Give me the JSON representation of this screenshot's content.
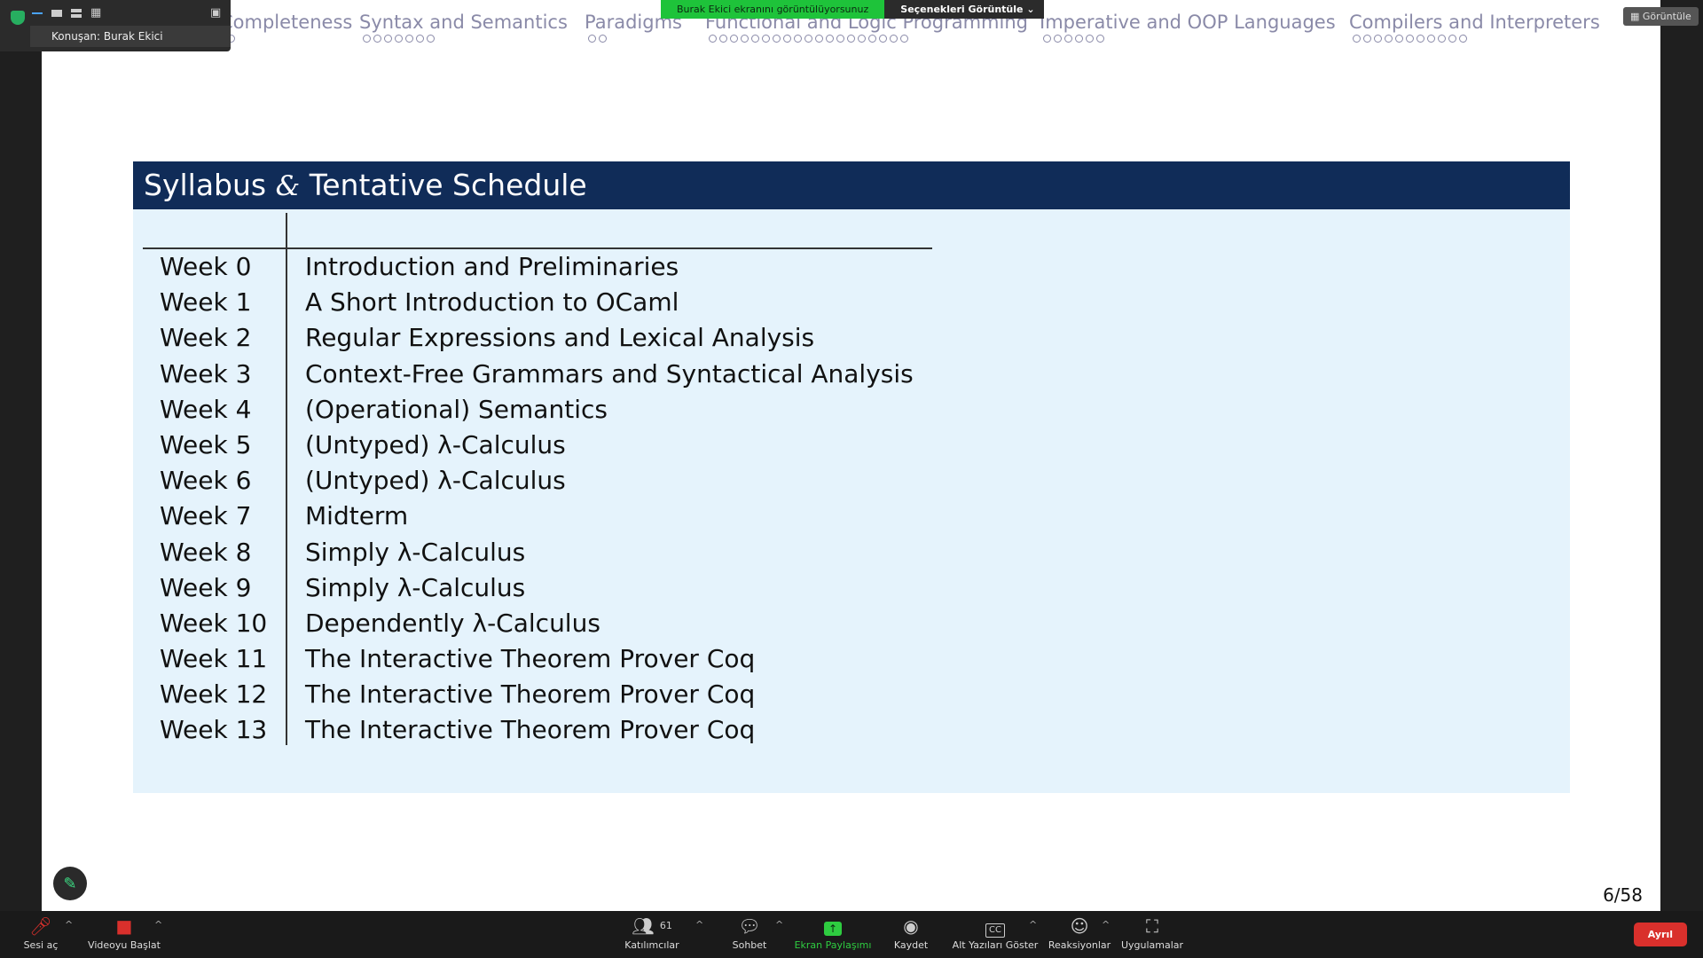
{
  "meeting": {
    "speaker_label": "Konuşan: Burak Ekici",
    "share_banner": "Burak Ekici ekranını görüntülüyorsunuz",
    "view_options": "Seçenekleri Görüntüle",
    "view_button": "Görüntüle"
  },
  "slide": {
    "nav": [
      {
        "label": "g Completeness",
        "dots": 3
      },
      {
        "label": "Syntax and Semantics",
        "dots": 7
      },
      {
        "label": "Paradigms",
        "dots": 2
      },
      {
        "label": "Functional and Logic Programming",
        "dots": 19
      },
      {
        "label": "Imperative and OOP Languages",
        "dots": 6
      },
      {
        "label": "Compilers and Interpreters",
        "dots": 11
      }
    ],
    "title_part1": "Syllabus",
    "title_amp": "&",
    "title_part2": "Tentative Schedule",
    "schedule": [
      {
        "week": "Week 0",
        "topic": "Introduction and Preliminaries"
      },
      {
        "week": "Week 1",
        "topic": "A Short Introduction to OCaml"
      },
      {
        "week": "Week 2",
        "topic": "Regular Expressions and Lexical Analysis"
      },
      {
        "week": "Week 3",
        "topic": "Context-Free Grammars and Syntactical Analysis"
      },
      {
        "week": "Week 4",
        "topic": "(Operational) Semantics"
      },
      {
        "week": "Week 5",
        "topic": "(Untyped) λ-Calculus"
      },
      {
        "week": "Week 6",
        "topic": "(Untyped) λ-Calculus"
      },
      {
        "week": "Week 7",
        "topic": "Midterm"
      },
      {
        "week": "Week 8",
        "topic": "Simply λ-Calculus"
      },
      {
        "week": "Week 9",
        "topic": "Simply λ-Calculus"
      },
      {
        "week": "Week 10",
        "topic": "Dependently λ-Calculus"
      },
      {
        "week": "Week 11",
        "topic": "The Interactive Theorem Prover Coq"
      },
      {
        "week": "Week 12",
        "topic": "The Interactive Theorem Prover Coq"
      },
      {
        "week": "Week 13",
        "topic": "The Interactive Theorem Prover Coq"
      }
    ],
    "page": "6/58"
  },
  "toolbar": {
    "unmute": "Sesi aç",
    "start_video": "Videoyu Başlat",
    "participants": "Katılımcılar",
    "participants_count": "61",
    "chat": "Sohbet",
    "share": "Ekran Paylaşımı",
    "record": "Kaydet",
    "captions": "Alt Yazıları Göster",
    "reactions": "Reaksiyonlar",
    "apps": "Uygulamalar",
    "leave": "Ayrıl"
  },
  "colors": {
    "title_bar": "#102c58",
    "frame_bg": "#e5f3fc",
    "nav_text": "#8a8aa8",
    "share_green": "#1ec33a",
    "leave_red": "#d9302c"
  }
}
